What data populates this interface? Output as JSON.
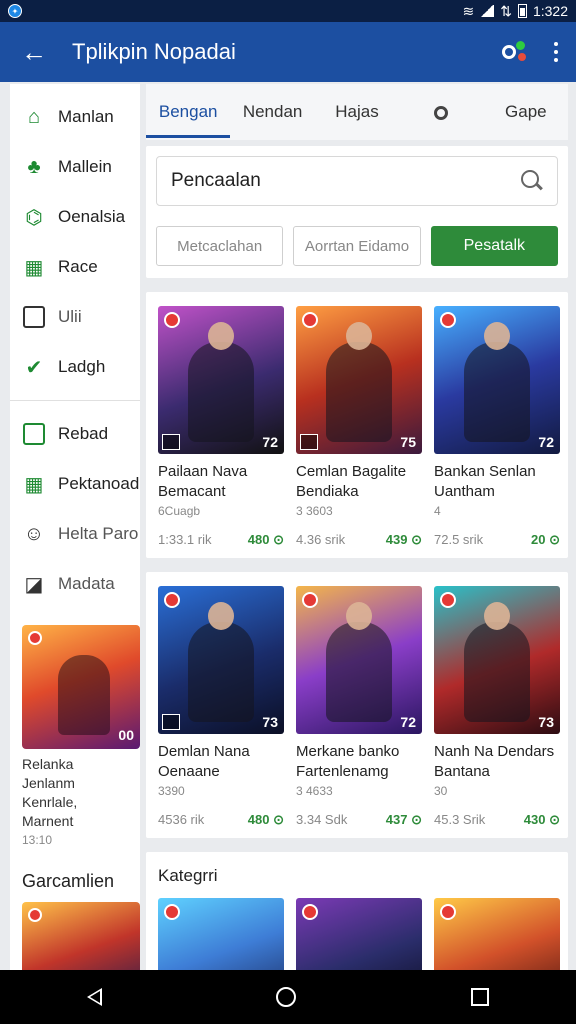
{
  "status_bar": {
    "time": "1:322"
  },
  "app_bar": {
    "title": "Tplikpin Nopadai"
  },
  "sidebar": {
    "items_top": [
      {
        "label": "Manlan",
        "icon": "home-icon"
      },
      {
        "label": "Mallein",
        "icon": "gamepad-icon"
      },
      {
        "label": "Oenalsia",
        "icon": "graduation-cap-icon"
      },
      {
        "label": "Race",
        "icon": "grid-icon"
      },
      {
        "label": "Ulii",
        "icon": "window-icon"
      },
      {
        "label": "Ladgh",
        "icon": "check-leaf-icon"
      }
    ],
    "items_bottom": [
      {
        "label": "Rebad",
        "icon": "board-icon"
      },
      {
        "label": "Pektanoad",
        "icon": "grid-icon"
      },
      {
        "label": "Helta Paro",
        "icon": "people-icon"
      },
      {
        "label": "Madata",
        "icon": "image-icon"
      }
    ],
    "promo": {
      "title": "Relanka Jenlanm Kenrlale, Marnent",
      "meta": "13:10",
      "badge": "00"
    },
    "section_title": "Garcamlien"
  },
  "tabs": [
    "Bengan",
    "Nendan",
    "Hajas",
    "",
    "Gape"
  ],
  "search": {
    "placeholder": "Pencaalan"
  },
  "filters": {
    "left": "Metcaclahan",
    "middle": "Aorrtan Eidamo",
    "primary": "Pesatalk"
  },
  "games_row1": [
    {
      "title": "Pailaan Nava Bemacant",
      "sub": "6Cuagb",
      "size": "1:33.1 rik",
      "price": "480 ⊙",
      "age": "72"
    },
    {
      "title": "Cemlan Bagalite Bendiaka",
      "sub": "3 3603",
      "size": "4.36 srik",
      "price": "439 ⊙",
      "age": "75"
    },
    {
      "title": "Bankan Senlan Uantham",
      "sub": "4",
      "size": "72.5 srik",
      "price": "20 ⊙",
      "age": "72"
    }
  ],
  "games_row2": [
    {
      "title": "Demlan Nana Oenaane",
      "sub": "3390",
      "size": "4536 rik",
      "price": "480 ⊙",
      "age": "73"
    },
    {
      "title": "Merkane banko Fartenlenamg",
      "sub": "3 4633",
      "size": "3.34 Sdk",
      "price": "437 ⊙",
      "age": "72"
    },
    {
      "title": "Nanh Na Dendars Bantana",
      "sub": "30",
      "size": "45.3 Srik",
      "price": "430 ⊙",
      "age": "73"
    }
  ],
  "category": {
    "title": "Kategrri"
  },
  "colors": {
    "app_bar": "#1c4fa1",
    "accent_green": "#2e8b3a",
    "status_bar": "#0b1f44"
  }
}
